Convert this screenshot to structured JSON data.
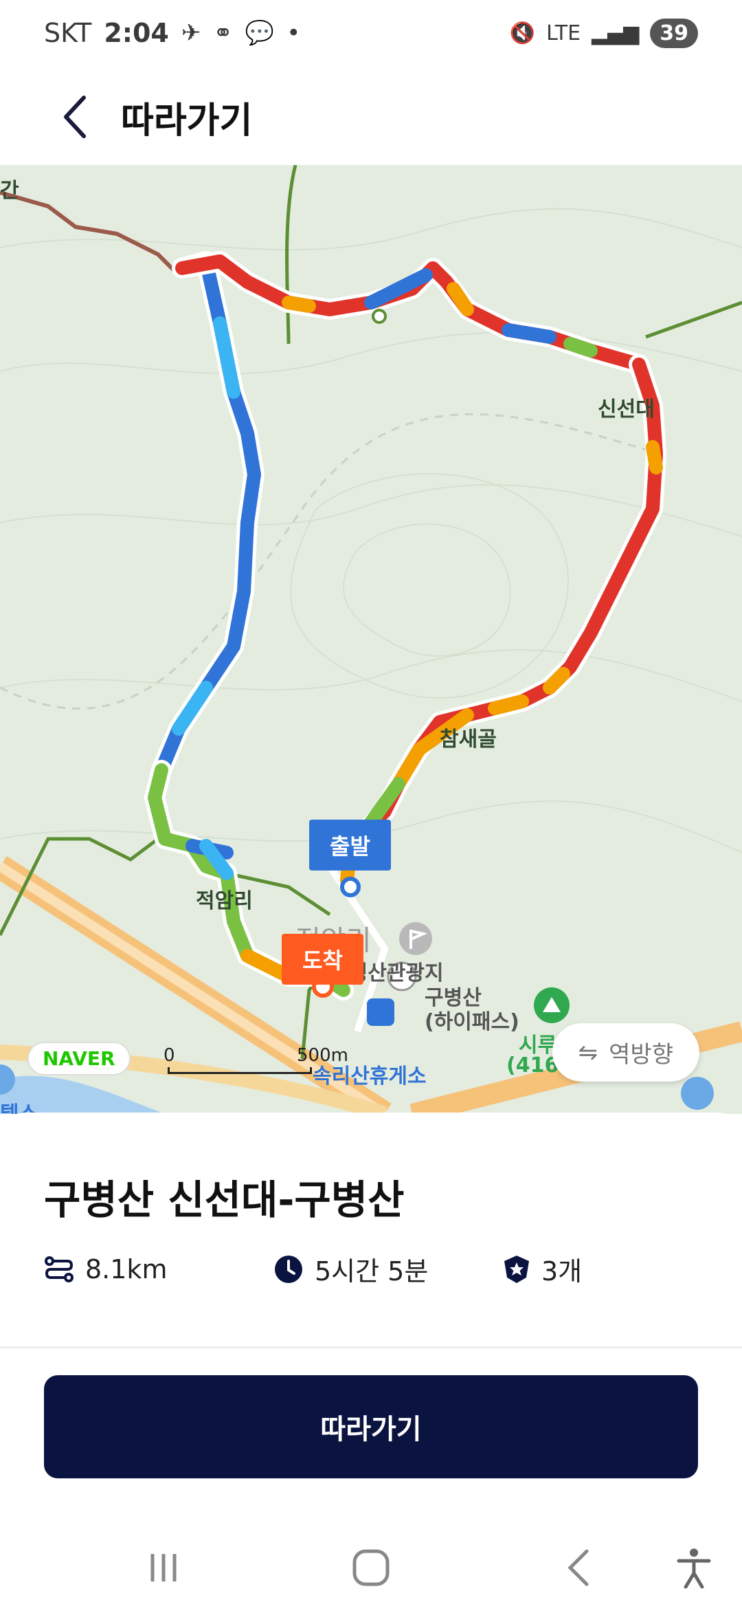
{
  "status_bar": {
    "carrier": "SKT",
    "time": "2:04",
    "battery": "39",
    "network": "LTE"
  },
  "header": {
    "title": "따라가기",
    "back_icon": "chevron-left-icon"
  },
  "map": {
    "labels": {
      "gan": "간",
      "sinseondae": "신선대",
      "chamsaegol": "참새골",
      "jeogamri": "적암리",
      "jeogamri_big": "적암리",
      "gubyeongsan_tourist": "구병산관광지",
      "gubyeongsan_hipass": "구병산\n(하이패스)",
      "rest_area": "속리산휴게소",
      "si": "시루",
      "elev": "(416",
      "tel": "텔스"
    },
    "start_marker": "출발",
    "end_marker": "도착",
    "logo": "NAVER",
    "scale_zero": "0",
    "scale_dist": "500m",
    "reverse_button": "역방향",
    "colors": {
      "route_blue": "#2f74d6",
      "route_lightblue": "#3ab4f2",
      "route_red": "#e0342a",
      "route_orange": "#f4a000",
      "route_green": "#7ac143",
      "trail_green": "#5c8f34",
      "trail_brown": "#9b5a4a",
      "road": "#f6c27a"
    }
  },
  "course": {
    "title": "구병산 신선대-구병산",
    "distance": "8.1km",
    "duration": "5시간 5분",
    "badges": "3개"
  },
  "actions": {
    "follow_button": "따라가기"
  }
}
